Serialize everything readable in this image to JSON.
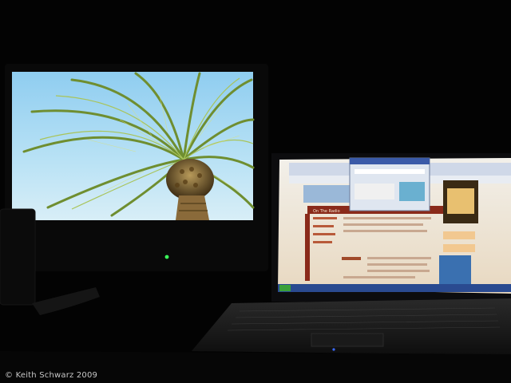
{
  "photo": {
    "copyright": "© Keith Schwarz 2009"
  },
  "scene": {
    "monitor_wallpaper": "palm-tree-photo",
    "laptop_site_nav": [
      "Welcome",
      "Radio",
      "Archive",
      "Shop"
    ],
    "laptop_show_title": "This American Life",
    "laptop_section": "On The Radio",
    "colors": {
      "sky": "#9fd6f2",
      "palm_frond": "#7a9a3a",
      "laptop_page": "#f4e6cf",
      "laptop_accent": "#8a2a1a",
      "power_led": "#3aff5a"
    }
  }
}
